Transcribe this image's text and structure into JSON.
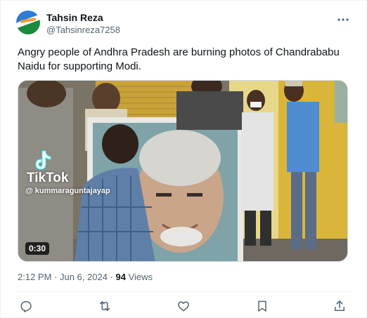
{
  "author": {
    "name": "Tahsin Reza",
    "handle": "@Tahsinreza7258"
  },
  "tweet": {
    "text": "Angry people of Andhra Pradesh are burning photos of Chandrababu Naidu for supporting Modi."
  },
  "media": {
    "watermark_brand": "TikTok",
    "watermark_user": "@ kummaraguntajayap",
    "duration": "0:30"
  },
  "meta": {
    "time": "2:12 PM",
    "separator": " · ",
    "date": "Jun 6, 2024",
    "views_count": "94",
    "views_label": " Views"
  },
  "icons": {
    "more": "more-dots-icon",
    "reply": "reply-icon",
    "retweet": "retweet-icon",
    "like": "heart-icon",
    "bookmark": "bookmark-icon",
    "share": "share-icon"
  },
  "colors": {
    "text_primary": "#0f1419",
    "text_secondary": "#536471",
    "border": "#eff3f4"
  }
}
